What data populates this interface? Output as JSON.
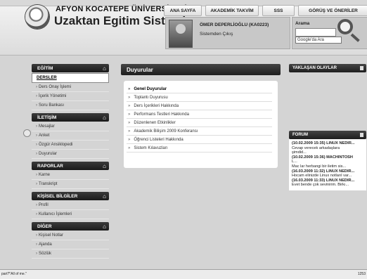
{
  "header": {
    "university": "AFYON KOCATEPE ÜNİVERSİTESİ",
    "system": "Uzaktan Egitim Sistemi",
    "nav": [
      "ANA SAYFA",
      "AKADEMİK TAKVİM",
      "SSS",
      "GÖRÜŞ VE ÖNERİLER"
    ],
    "user_name": "ÖMER DEPERLİOĞLU (KA0223)",
    "logout": "Sistemden Çıkış",
    "search_label": "Arama",
    "search_value": "",
    "google_button": "Google'da Ara"
  },
  "sidebar": {
    "sections": [
      {
        "title": "EĞİTİM",
        "items": [
          "DERSLER",
          "Ders Onay İşlemi",
          "İçerik Yönetimi",
          "Soru Bankası"
        ]
      },
      {
        "title": "İLETİŞİM",
        "items": [
          "Mesajlar",
          "Anket",
          "Özgür Ansiklopedi",
          "Duyurular"
        ]
      },
      {
        "title": "RAPORLAR",
        "items": [
          "Karne",
          "Transkript"
        ]
      },
      {
        "title": "KİŞİSEL BİLGİLER",
        "items": [
          "Profil",
          "Kullanıcı İşlemleri"
        ]
      },
      {
        "title": "DİĞER",
        "items": [
          "Kişisel Notlar",
          "Ajanda",
          "Sözlük"
        ]
      }
    ]
  },
  "content": {
    "title": "Duyurular",
    "links": [
      "Genel Duyurular",
      "Toplantı Duyurusu",
      "Ders İçerikleri Hakkında",
      "Performans Testleri Hakkında",
      "Düzenlenen Etkinlikler",
      "Akademik Bilişim 2009 Konferansı",
      "Öğrenci Listeleri Hakkında",
      "Sistem Kılavuzları"
    ]
  },
  "right": {
    "events_title": "YAKLAŞAN OLAYLAR",
    "forum_title": "FORUM",
    "forum_lines": [
      {
        "text": "(10.02.2009 15:35) LINUX NEDİR...",
        "bold": true
      },
      {
        "text": "Cevap verecek arkadaşlara",
        "bold": false
      },
      {
        "text": "şimdid...",
        "bold": false
      },
      {
        "text": "(10.02.2009 15:36) MACHINTOSH",
        "bold": true
      },
      {
        "text": "L...",
        "bold": false
      },
      {
        "text": "Mac lar herbangi bir iletim sis...",
        "bold": false
      },
      {
        "text": "(16.03.2009 11:32) LINUX NEDİR...",
        "bold": true
      },
      {
        "text": "Hocam elinizde Linux notlarıl var...",
        "bold": false
      },
      {
        "text": "(16.03.2009 11:33) LINUX NEDİR...",
        "bold": true
      },
      {
        "text": "Evet bende çok sevinirim. Birkı...",
        "bold": false
      }
    ]
  },
  "status": {
    "left": "part?\"All of me.\"",
    "right": "1253"
  }
}
